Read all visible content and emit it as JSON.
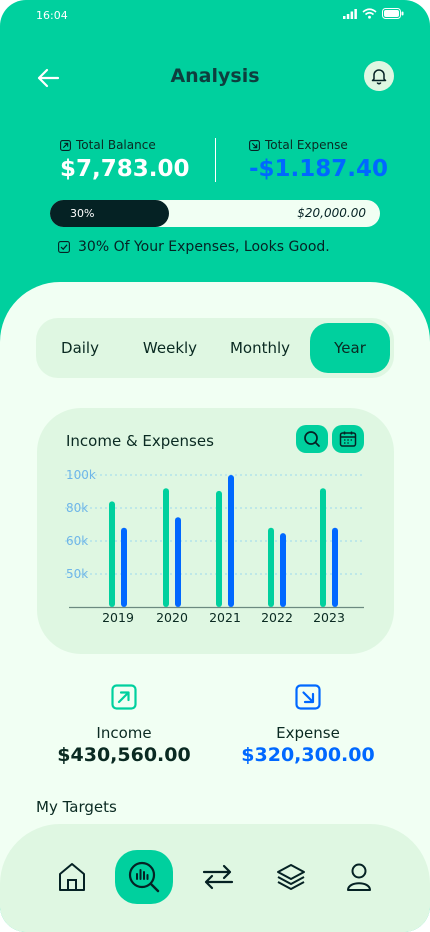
{
  "status_bar": {
    "time": "16:04"
  },
  "header": {
    "title": "Analysis"
  },
  "balance": {
    "total_label": "Total Balance",
    "total_value": "$7,783.00",
    "expense_label": "Total Expense",
    "expense_value": "-$1.187.40"
  },
  "progress": {
    "percent_label": "30%",
    "fraction": 0.3,
    "target": "$20,000.00"
  },
  "message": "30% Of Your Expenses, Looks Good.",
  "tabs": [
    {
      "label": "Daily",
      "active": false
    },
    {
      "label": "Weekly",
      "active": false
    },
    {
      "label": "Monthly",
      "active": false
    },
    {
      "label": "Year",
      "active": true
    }
  ],
  "chart": {
    "title": "Income & Expenses"
  },
  "chart_data": {
    "type": "bar",
    "title": "Income & Expenses",
    "categories": [
      "2019",
      "2020",
      "2021",
      "2022",
      "2023"
    ],
    "series": [
      {
        "values": [
          80,
          90,
          88,
          60,
          90
        ],
        "color": "#00d09e"
      },
      {
        "values": [
          60,
          68,
          100,
          56,
          60
        ],
        "color": "#0068ff"
      }
    ],
    "ytick_labels": [
      "100k",
      "80k",
      "60k",
      "50k"
    ],
    "grid": true
  },
  "summary": {
    "income_label": "Income",
    "income_value": "$430,560.00",
    "expense_label": "Expense",
    "expense_value": "$320,300.00"
  },
  "targets_title": "My Targets",
  "nav": [
    {
      "icon": "home-icon",
      "active": false
    },
    {
      "icon": "analysis-icon",
      "active": true
    },
    {
      "icon": "transactions-icon",
      "active": false
    },
    {
      "icon": "categories-icon",
      "active": false
    },
    {
      "icon": "profile-icon",
      "active": false
    }
  ],
  "colors": {
    "primary": "#00d09e",
    "dark": "#052224",
    "blue": "#0068ff",
    "light": "#f1fff3",
    "card": "#dff7e2"
  }
}
